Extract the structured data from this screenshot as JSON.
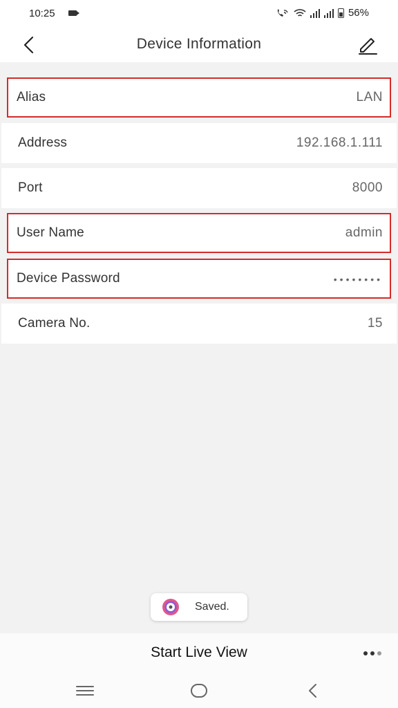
{
  "status": {
    "time": "10:25",
    "battery": "56%"
  },
  "header": {
    "title": "Device Information"
  },
  "fields": [
    {
      "label": "Alias",
      "value": "LAN"
    },
    {
      "label": "Address",
      "value": "192.168.1.111"
    },
    {
      "label": "Port",
      "value": "8000"
    },
    {
      "label": "User Name",
      "value": "admin"
    },
    {
      "label": "Device Password",
      "value": "••••••••"
    },
    {
      "label": "Camera No.",
      "value": "15"
    }
  ],
  "toast": {
    "text": "Saved."
  },
  "bottom": {
    "start_label": "Start Live View"
  },
  "colors": {
    "highlight": "#d42b2b",
    "text": "#333333",
    "value": "#666666"
  }
}
